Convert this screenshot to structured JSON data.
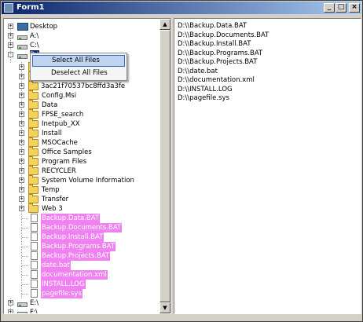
{
  "window": {
    "title": "Form1",
    "minimize_label": "_",
    "maximize_label": "□",
    "close_label": "×"
  },
  "tree": {
    "drives": [
      {
        "label": "Desktop",
        "expander": "+"
      },
      {
        "label": "A:\\",
        "expander": "+"
      },
      {
        "label": "C:\\",
        "expander": "+"
      },
      {
        "label": "D:\\",
        "expander": "-"
      }
    ],
    "partial_row_label": "3ac21f70537bc8ffd3a3fe",
    "folders": [
      "Config.Msi",
      "Data",
      "FPSE_search",
      "Inetpub_XX",
      "Install",
      "MSOCache",
      "Office Samples",
      "Program Files",
      "RECYCLER",
      "System Volume Information",
      "Temp",
      "Transfer",
      "Web 3"
    ],
    "files": [
      "Backup.Data.BAT",
      "Backup.Documents.BAT",
      "Backup.Install.BAT",
      "Backup.Programs.BAT",
      "Backup.Projects.BAT",
      "date.bat",
      "documentation.xml",
      "INSTALL.LOG",
      "pagefile.sys"
    ],
    "bottom_drives": [
      {
        "label": "E:\\",
        "expander": "+"
      },
      {
        "label": "F:\\",
        "expander": "+"
      }
    ],
    "plus": "+",
    "selection_color": "#f081f0"
  },
  "context_menu": {
    "select_all": "Select All Files",
    "deselect_all": "Deselect All Files"
  },
  "file_list": [
    "D:\\\\Backup.Data.BAT",
    "D:\\\\Backup.Documents.BAT",
    "D:\\\\Backup.Install.BAT",
    "D:\\\\Backup.Programs.BAT",
    "D:\\\\Backup.Projects.BAT",
    "D:\\\\date.bat",
    "D:\\\\documentation.xml",
    "D:\\\\INSTALL.LOG",
    "D:\\\\pagefile.sys"
  ],
  "scrollbar": {
    "up_arrow": "▲",
    "down_arrow": "▼"
  }
}
